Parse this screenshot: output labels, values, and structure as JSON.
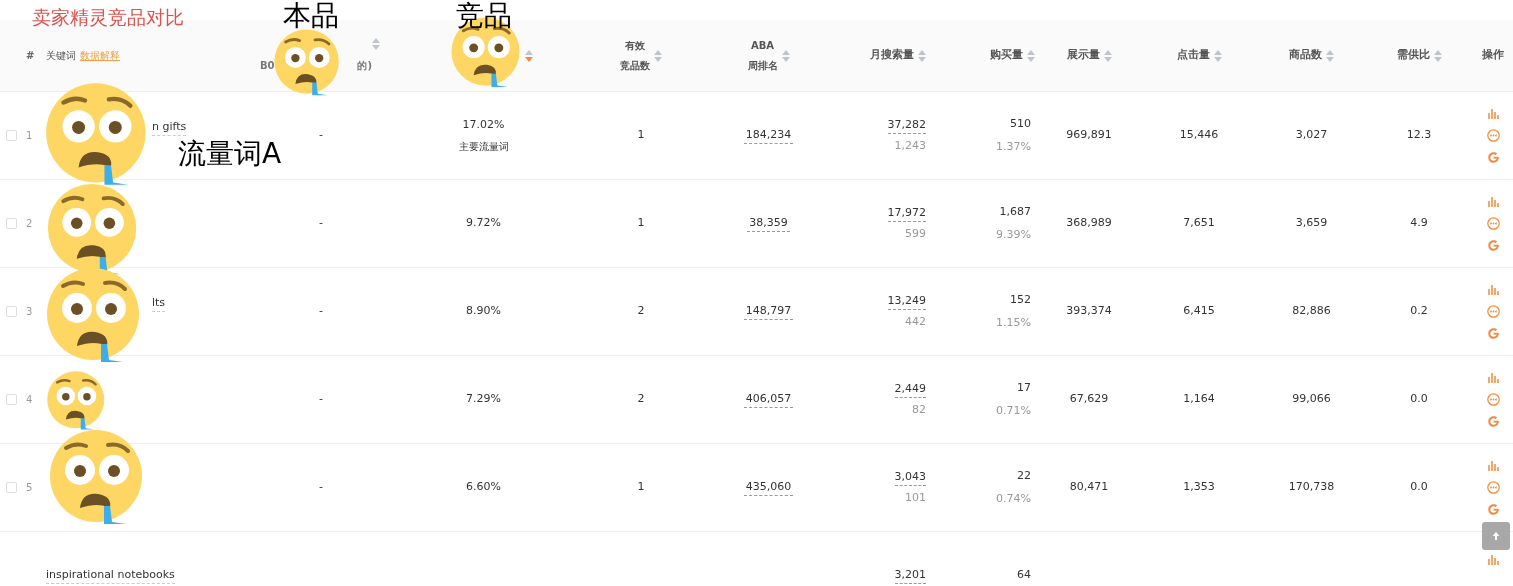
{
  "overlay": {
    "title": "卖家精灵竞品对比",
    "labels": [
      {
        "text": "本品",
        "kind": "own"
      },
      {
        "text": "竞品",
        "kind": "rival"
      },
      {
        "text": "流量词A",
        "kind": "keyword"
      }
    ]
  },
  "header": {
    "index": "#",
    "keyword": "关键词",
    "keyword_link": "数据解释",
    "own_left": "B0",
    "own_right": "的)",
    "rival_sorted": true,
    "competitors": [
      "有效",
      "竞品数"
    ],
    "aba": [
      "ABA",
      "周排名"
    ],
    "searches": "月搜索量",
    "purchases": "购买量",
    "impressions": "展示量",
    "clicks": "点击量",
    "products": "商品数",
    "ratio": "需供比",
    "actions": "操作"
  },
  "rows": [
    {
      "checked": false,
      "index": "1",
      "keyword": "n gifts",
      "obscured": true,
      "own": "-",
      "share": "17.02%",
      "tag": "主要流量词",
      "competitors": "1",
      "aba": "184,234",
      "searches": "37,282",
      "searches_sub": "1,243",
      "purchases": "510",
      "purchase_rate": "1.37%",
      "impressions": "969,891",
      "clicks": "15,446",
      "products": "3,027",
      "ratio": "12.3",
      "actions": [
        {
          "kind": "chart"
        },
        {
          "kind": "more"
        },
        {
          "kind": "google"
        }
      ]
    },
    {
      "checked": false,
      "index": "2",
      "own": "-",
      "share": "9.72%",
      "competitors": "1",
      "aba": "38,359",
      "searches": "17,972",
      "searches_sub": "599",
      "purchases": "1,687",
      "purchase_rate": "9.39%",
      "impressions": "368,989",
      "clicks": "7,651",
      "products": "3,659",
      "ratio": "4.9",
      "actions": [
        {
          "kind": "chart"
        },
        {
          "kind": "more"
        },
        {
          "kind": "google"
        }
      ]
    },
    {
      "checked": false,
      "index": "3",
      "keyword": "lts",
      "obscured": true,
      "own": "-",
      "share": "8.90%",
      "competitors": "2",
      "aba": "148,797",
      "searches": "13,249",
      "searches_sub": "442",
      "purchases": "152",
      "purchase_rate": "1.15%",
      "impressions": "393,374",
      "clicks": "6,415",
      "products": "82,886",
      "ratio": "0.2",
      "actions": [
        {
          "kind": "chart"
        },
        {
          "kind": "more"
        },
        {
          "kind": "google"
        }
      ]
    },
    {
      "checked": false,
      "index": "4",
      "own": "-",
      "share": "7.29%",
      "competitors": "2",
      "aba": "406,057",
      "searches": "2,449",
      "searches_sub": "82",
      "purchases": "17",
      "purchase_rate": "0.71%",
      "impressions": "67,629",
      "clicks": "1,164",
      "products": "99,066",
      "ratio": "0.0",
      "actions": [
        {
          "kind": "chart"
        },
        {
          "kind": "more"
        },
        {
          "kind": "google"
        }
      ]
    },
    {
      "checked": false,
      "index": "5",
      "own": "-",
      "share": "6.60%",
      "competitors": "1",
      "aba": "435,060",
      "searches": "3,043",
      "searches_sub": "101",
      "purchases": "22",
      "purchase_rate": "0.74%",
      "impressions": "80,471",
      "clicks": "1,353",
      "products": "170,738",
      "ratio": "0.0",
      "actions": [
        {
          "kind": "chart"
        },
        {
          "kind": "more"
        },
        {
          "kind": "google"
        }
      ]
    },
    {
      "keyword": "inspirational notebooks",
      "searches": "3,201",
      "purchases": "64",
      "actions": [
        {
          "kind": "chart"
        }
      ]
    }
  ]
}
